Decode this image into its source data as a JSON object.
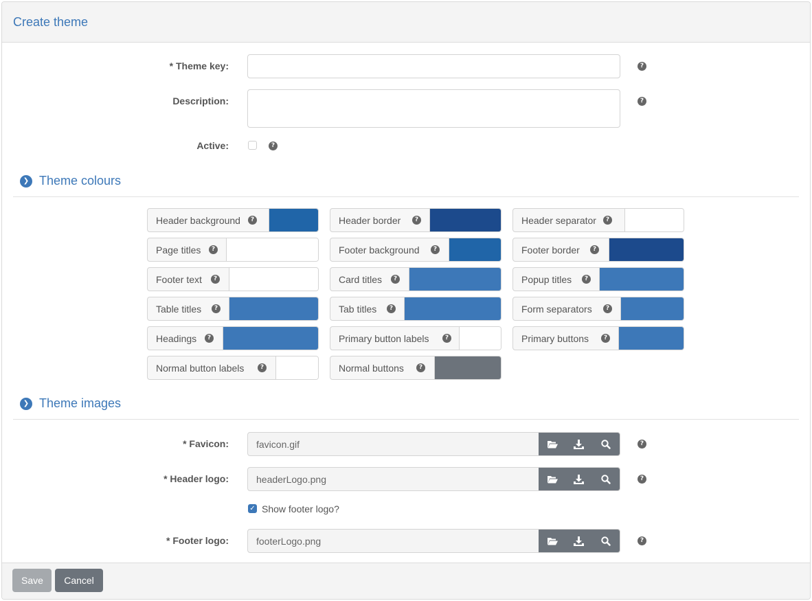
{
  "header": {
    "title": "Create theme"
  },
  "form": {
    "theme_key": {
      "label": "* Theme key:",
      "value": "",
      "placeholder": ""
    },
    "description": {
      "label": "Description:",
      "value": ""
    },
    "active": {
      "label": "Active:",
      "checked": false
    }
  },
  "sections": {
    "colours": {
      "title": "Theme colours"
    },
    "images": {
      "title": "Theme images"
    }
  },
  "colours": [
    {
      "label": "Header background",
      "color": "#2065a8"
    },
    {
      "label": "Header border",
      "color": "#1c4a8c"
    },
    {
      "label": "Header separator",
      "color": "#ffffff"
    },
    {
      "label": "Page titles",
      "color": "#ffffff"
    },
    {
      "label": "Footer background",
      "color": "#2065a8"
    },
    {
      "label": "Footer border",
      "color": "#1c4a8c"
    },
    {
      "label": "Footer text",
      "color": "#ffffff"
    },
    {
      "label": "Card titles",
      "color": "#3d78b8"
    },
    {
      "label": "Popup titles",
      "color": "#3d78b8"
    },
    {
      "label": "Table titles",
      "color": "#3d78b8"
    },
    {
      "label": "Tab titles",
      "color": "#3d78b8"
    },
    {
      "label": "Form separators",
      "color": "#3d78b8"
    },
    {
      "label": "Headings",
      "color": "#3d78b8"
    },
    {
      "label": "Primary button labels",
      "color": "#ffffff"
    },
    {
      "label": "Primary buttons",
      "color": "#3d78b8"
    },
    {
      "label": "Normal button labels",
      "color": "#ffffff"
    },
    {
      "label": "Normal buttons",
      "color": "#6c737b"
    }
  ],
  "images": {
    "favicon": {
      "label": "* Favicon:",
      "value": "favicon.gif"
    },
    "header_logo": {
      "label": "* Header logo:",
      "value": "headerLogo.png"
    },
    "show_footer_logo": {
      "label": "Show footer logo?",
      "checked": true
    },
    "footer_logo": {
      "label": "* Footer logo:",
      "value": "footerLogo.png"
    }
  },
  "footer": {
    "save_label": "Save",
    "cancel_label": "Cancel"
  },
  "icons": {
    "help": "question-circle-icon",
    "section": "chevron-circle-down-icon",
    "browse": "folder-open-icon",
    "download": "download-icon",
    "view": "magnifier-icon"
  },
  "theme": {
    "accent": "#3d78b8",
    "button_dark": "#6c737b",
    "button_disabled": "#a5a9ad"
  }
}
